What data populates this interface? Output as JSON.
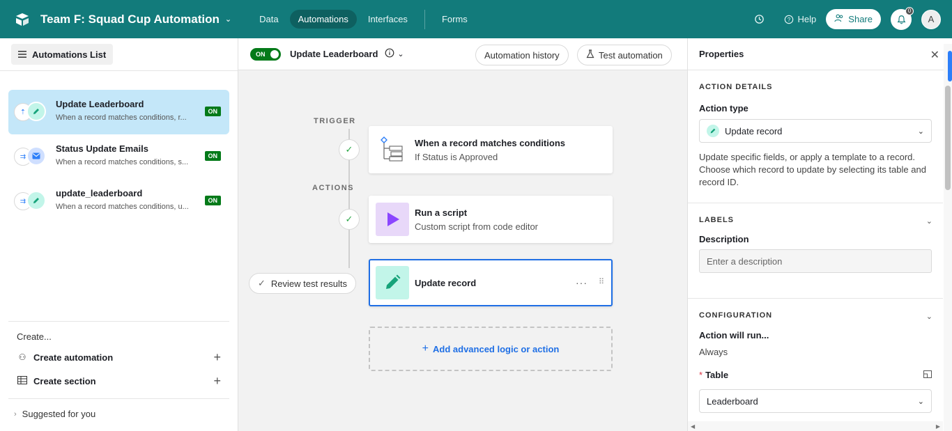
{
  "topbar": {
    "base_name": "Team F: Squad Cup Automation",
    "tabs": [
      {
        "label": "Data"
      },
      {
        "label": "Automations"
      },
      {
        "label": "Interfaces"
      },
      {
        "label": "Forms"
      }
    ],
    "help_label": "Help",
    "share_label": "Share",
    "notification_count": "0",
    "avatar_initial": "A",
    "brand_color": "#127b7b"
  },
  "left": {
    "list_button_label": "Automations List",
    "automations": [
      {
        "name": "Update Leaderboard",
        "description": "When a record matches conditions, r...",
        "status": "ON"
      },
      {
        "name": "Status Update Emails",
        "description": "When a record matches conditions, s...",
        "status": "ON"
      },
      {
        "name": "update_leaderboard",
        "description": "When a record matches conditions, u...",
        "status": "ON"
      }
    ],
    "create_title": "Create...",
    "create_automation_label": "Create automation",
    "create_section_label": "Create section",
    "suggested_label": "Suggested for you"
  },
  "center": {
    "toggle_label": "ON",
    "automation_title": "Update Leaderboard",
    "history_button": "Automation history",
    "test_button": "Test automation",
    "trigger_label": "TRIGGER",
    "actions_label": "ACTIONS",
    "trigger_card": {
      "title": "When a record matches conditions",
      "subtitle": "If Status is Approved"
    },
    "script_card": {
      "title": "Run a script",
      "subtitle": "Custom script from code editor"
    },
    "update_card": {
      "title": "Update record"
    },
    "review_button": "Review test results",
    "add_button": "Add advanced logic or action"
  },
  "right": {
    "title": "Properties",
    "action_details_title": "ACTION DETAILS",
    "action_type_label": "Action type",
    "action_type_value": "Update record",
    "action_description": "Update specific fields, or apply a template to a record. Choose which record to update by selecting its table and record ID.",
    "labels_title": "LABELS",
    "description_label": "Description",
    "description_placeholder": "Enter a description",
    "configuration_title": "CONFIGURATION",
    "run_label": "Action will run...",
    "run_value": "Always",
    "table_label": "Table",
    "table_required_mark": "*",
    "table_value": "Leaderboard"
  }
}
